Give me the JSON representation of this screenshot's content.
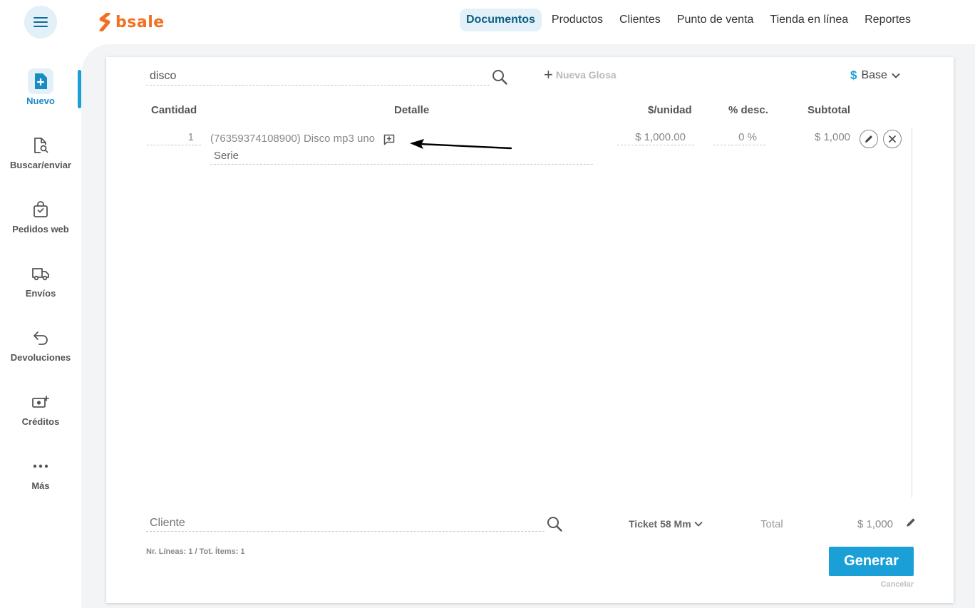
{
  "header": {
    "logo_text": "bsale",
    "nav": [
      {
        "label": "Documentos"
      },
      {
        "label": "Productos"
      },
      {
        "label": "Clientes"
      },
      {
        "label": "Punto de venta"
      },
      {
        "label": "Tienda en línea"
      },
      {
        "label": "Reportes"
      }
    ],
    "active_nav": "Documentos"
  },
  "sidebar": {
    "items": [
      {
        "label": "Nuevo",
        "icon": "new-document-icon"
      },
      {
        "label": "Buscar/enviar",
        "icon": "search-document-icon"
      },
      {
        "label": "Pedidos web",
        "icon": "shopping-bag-icon"
      },
      {
        "label": "Envíos",
        "icon": "truck-icon"
      },
      {
        "label": "Devoluciones",
        "icon": "return-arrow-icon"
      },
      {
        "label": "Créditos",
        "icon": "credit-money-icon"
      },
      {
        "label": "Más",
        "icon": "more-dots-icon"
      }
    ],
    "active": "Nuevo"
  },
  "document": {
    "search_value": "disco",
    "new_gloss_label": "Nueva Glosa",
    "price_list_symbol": "$",
    "price_list_label": "Base",
    "columns": {
      "quantity": "Cantidad",
      "detail": "Detalle",
      "unit_price": "$/unidad",
      "discount": "% desc.",
      "subtotal": "Subtotal"
    },
    "line": {
      "quantity": "1",
      "detail": "(76359374108900) Disco mp3 uno",
      "serie": "Serie",
      "unit_price": "$ 1,000.00",
      "discount": "0 %",
      "subtotal": "$ 1,000"
    },
    "client_placeholder": "Cliente",
    "doc_type_label": "Ticket 58 Mm",
    "total_label": "Total",
    "total_value": "$ 1,000",
    "lines_info": "Nr. Líneas: 1 / Tot. Ítems: 1",
    "generate_label": "Generar",
    "cancel_label": "Cancelar"
  },
  "colors": {
    "brand_orange": "#f36f21",
    "accent_blue": "#1a9fd6",
    "active_bg": "#e3f0f8"
  }
}
